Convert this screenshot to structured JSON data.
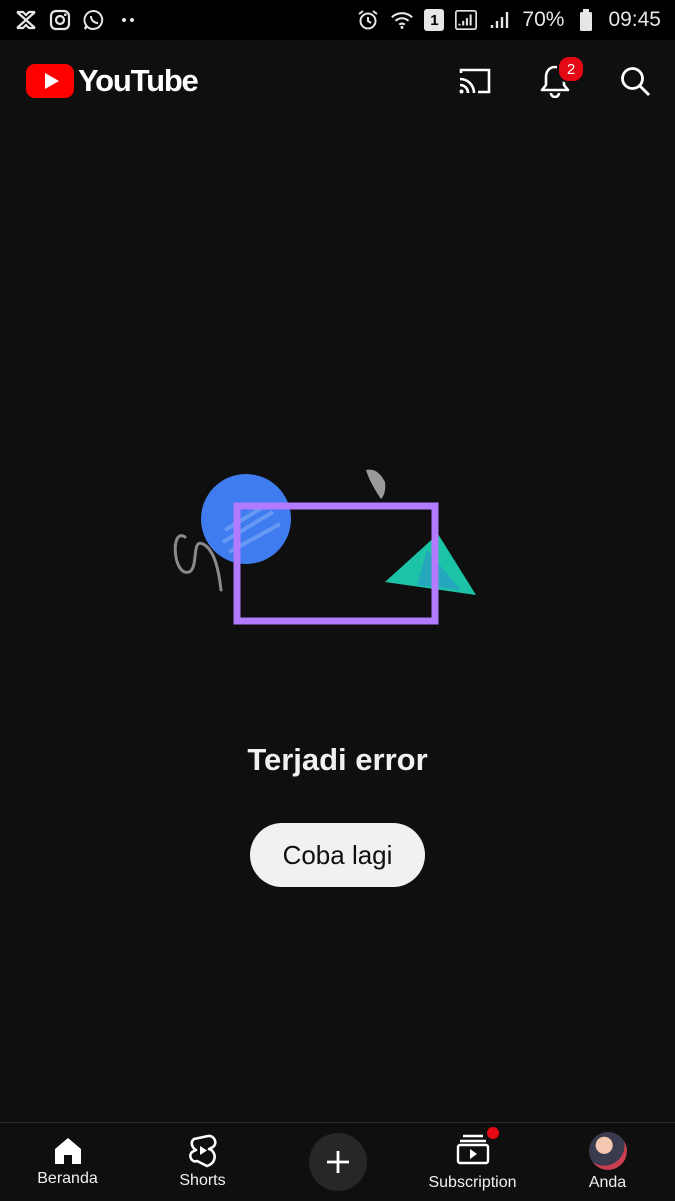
{
  "status_bar": {
    "battery": "70%",
    "time": "09:45",
    "sim_slot": "1",
    "left_icons": [
      "capcut-icon",
      "instagram-icon",
      "whatsapp-icon",
      "more-dots-icon"
    ],
    "right_icons": [
      "alarm-icon",
      "wifi-icon",
      "sim-icon",
      "signal-icon",
      "signal-icon",
      "battery-icon"
    ]
  },
  "header": {
    "logo_text": "YouTube",
    "notification_count": "2",
    "brand_color": "#ff0000"
  },
  "error": {
    "title": "Terjadi error",
    "retry_label": "Coba lagi"
  },
  "bottom_nav": {
    "items": [
      {
        "label": "Beranda",
        "icon": "home-icon"
      },
      {
        "label": "Shorts",
        "icon": "shorts-icon"
      },
      {
        "label": "",
        "icon": "create-plus-icon"
      },
      {
        "label": "Subscription",
        "icon": "subscriptions-icon"
      },
      {
        "label": "Anda",
        "icon": "avatar"
      }
    ]
  }
}
